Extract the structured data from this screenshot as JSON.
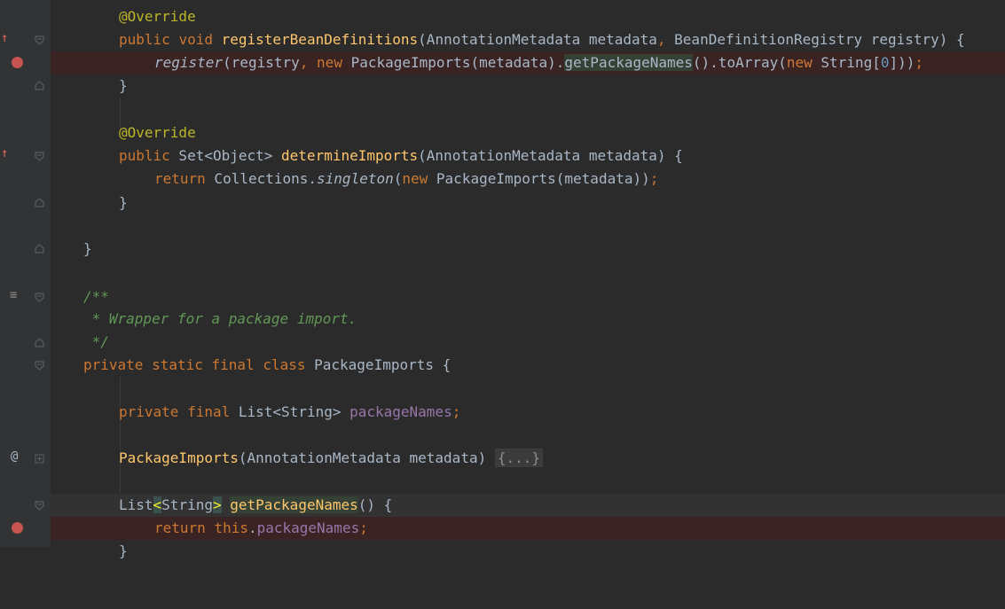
{
  "editor": {
    "lines": {
      "l0": {
        "ann": "@Override"
      },
      "l1": {
        "public": "public",
        "void": "void",
        "name": "registerBeanDefinitions",
        "params1": "(AnnotationMetadata metadata",
        "comma": ",",
        "params2": " BeanDefinitionRegistry registry) {"
      },
      "l2": {
        "call": "register",
        "args": "(registry",
        "comma": ",",
        "new": "new",
        "ctor": " PackageImports(metadata).",
        "hl": "getPackageNames",
        "rest": "().toArray(",
        "new2": "new",
        "str": " String[",
        "zero": "0",
        "end": "])",
        "semi": ";"
      },
      "l3": {
        "text": "}"
      },
      "l5": {
        "ann": "@Override"
      },
      "l6": {
        "public": "public",
        "type": " Set<Object> ",
        "name": "determineImports",
        "params": "(AnnotationMetadata metadata) {"
      },
      "l7": {
        "ret": "return",
        "call1": " Collections.",
        "call2": "singleton",
        "open": "(",
        "new": "new",
        "rest": " PackageImports(metadata))",
        "semi": ";"
      },
      "l8": {
        "text": "}"
      },
      "l10": {
        "text": "}"
      },
      "l12": {
        "text": "/**"
      },
      "l13": {
        "text": " * Wrapper for a package import."
      },
      "l14": {
        "text": " */"
      },
      "l15": {
        "private": "private",
        "static": "static",
        "final": "final",
        "class": "class",
        "name": " PackageImports {"
      },
      "l17": {
        "private": "private",
        "final": "final",
        "type": " List<String> ",
        "field": "packageNames",
        "semi": ";"
      },
      "l19": {
        "name": "PackageImports",
        "params": "(AnnotationMetadata metadata) ",
        "fold": "{...}"
      },
      "l21": {
        "list": "List",
        "lt": "<",
        "string": "String",
        "gt": ">",
        "name": "getPackageNames",
        "rest": "() {"
      },
      "l22": {
        "ret": "return",
        "this": "this",
        "dot": ".",
        "field": "packageNames",
        "semi": ";"
      },
      "l23": {
        "text": "}"
      }
    }
  },
  "gutter": {
    "at_symbol": "@",
    "override_mark": "↑",
    "bookmark_mark": "≡"
  },
  "colors": {
    "background": "#2b2b2b",
    "keyword": "#cc7832",
    "annotation": "#bbb529",
    "method": "#ffc66d",
    "field": "#9876aa",
    "breakpoint": "#c75450"
  }
}
